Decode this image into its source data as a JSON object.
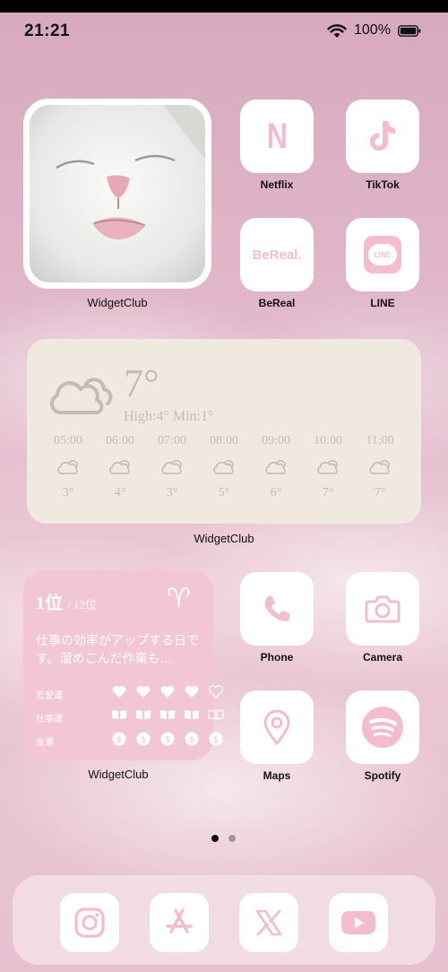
{
  "status_bar": {
    "time": "21:21",
    "battery": "100%"
  },
  "colors": {
    "accent": "#f2c6d4",
    "icon_pink": "#f3bcd0",
    "widget_bg": "#efe9df",
    "weather_text": "#c9b9b6"
  },
  "photo_widget": {
    "label": "WidgetClub"
  },
  "apps_top": [
    {
      "label": "Netflix",
      "icon": "netflix-icon",
      "glyph": "N"
    },
    {
      "label": "TikTok",
      "icon": "tiktok-icon"
    },
    {
      "label": "BeReal",
      "icon": "bereal-icon",
      "glyph": "BeReal."
    },
    {
      "label": "LINE",
      "icon": "line-icon",
      "glyph": "LINE"
    }
  ],
  "weather": {
    "temp": "7°",
    "hilo": "High:4° Min:1°",
    "hours": [
      {
        "time": "05:00",
        "temp": "3°"
      },
      {
        "time": "06:00",
        "temp": "4°"
      },
      {
        "time": "07:00",
        "temp": "3°"
      },
      {
        "time": "08:00",
        "temp": "5°"
      },
      {
        "time": "09:00",
        "temp": "6°"
      },
      {
        "time": "10:00",
        "temp": "7°"
      },
      {
        "time": "11:00",
        "temp": "7°"
      }
    ],
    "label": "WidgetClub"
  },
  "horoscope": {
    "rank": "1位",
    "total": "/ 12位",
    "sign": "♈",
    "message": "仕事の効率がアップする日です。溜めこんだ作業も…",
    "rows": [
      {
        "label": "恋愛運",
        "icon": "heart-icon",
        "filled": 4,
        "total": 5
      },
      {
        "label": "仕事運",
        "icon": "book-icon",
        "filled": 4,
        "total": 5
      },
      {
        "label": "金運",
        "icon": "coin-icon",
        "filled": 5,
        "total": 5
      }
    ],
    "widget_label": "WidgetClub"
  },
  "apps_bottom": [
    {
      "label": "Phone",
      "icon": "phone-icon"
    },
    {
      "label": "Camera",
      "icon": "camera-icon"
    },
    {
      "label": "Maps",
      "icon": "maps-icon"
    },
    {
      "label": "Spotify",
      "icon": "spotify-icon"
    }
  ],
  "page_indicator": {
    "current": 1,
    "total": 2
  },
  "dock": [
    {
      "icon": "instagram-icon"
    },
    {
      "icon": "app-store-icon"
    },
    {
      "icon": "x-icon"
    },
    {
      "icon": "youtube-icon"
    }
  ]
}
